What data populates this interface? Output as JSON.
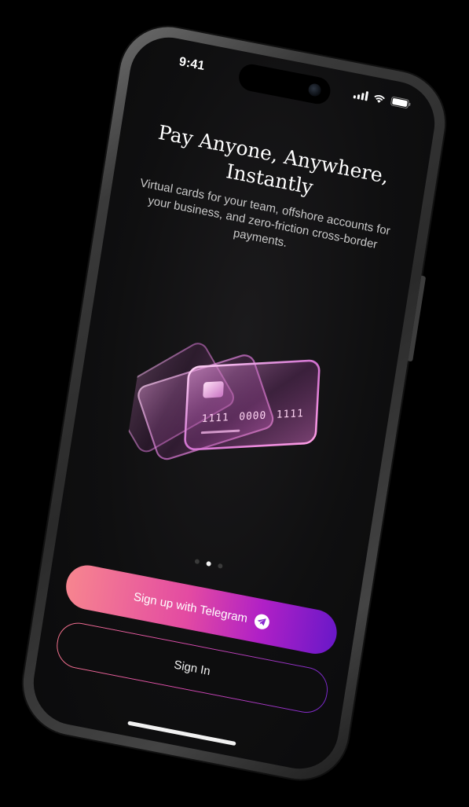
{
  "status_bar": {
    "time": "9:41"
  },
  "onboarding": {
    "title_line1": "Pay Anyone, Anywhere,",
    "title_line2": "Instantly",
    "subtitle": "Virtual cards for your team, offshore accounts for your business, and zero-friction cross-border payments.",
    "card_number_groups": [
      "1111",
      "0000",
      "1111"
    ],
    "pager": {
      "count": 3,
      "active_index": 1
    }
  },
  "actions": {
    "signup_label": "Sign up with Telegram",
    "signin_label": "Sign In"
  },
  "icons": {
    "signup": "telegram-icon",
    "status": [
      "signal-icon",
      "wifi-icon",
      "battery-icon"
    ]
  },
  "colors": {
    "background": "#0f0f10",
    "accent_start": "#f7858f",
    "accent_mid": "#e34aa2",
    "accent_end": "#6a18c8",
    "card_glow": "#d966c8"
  }
}
